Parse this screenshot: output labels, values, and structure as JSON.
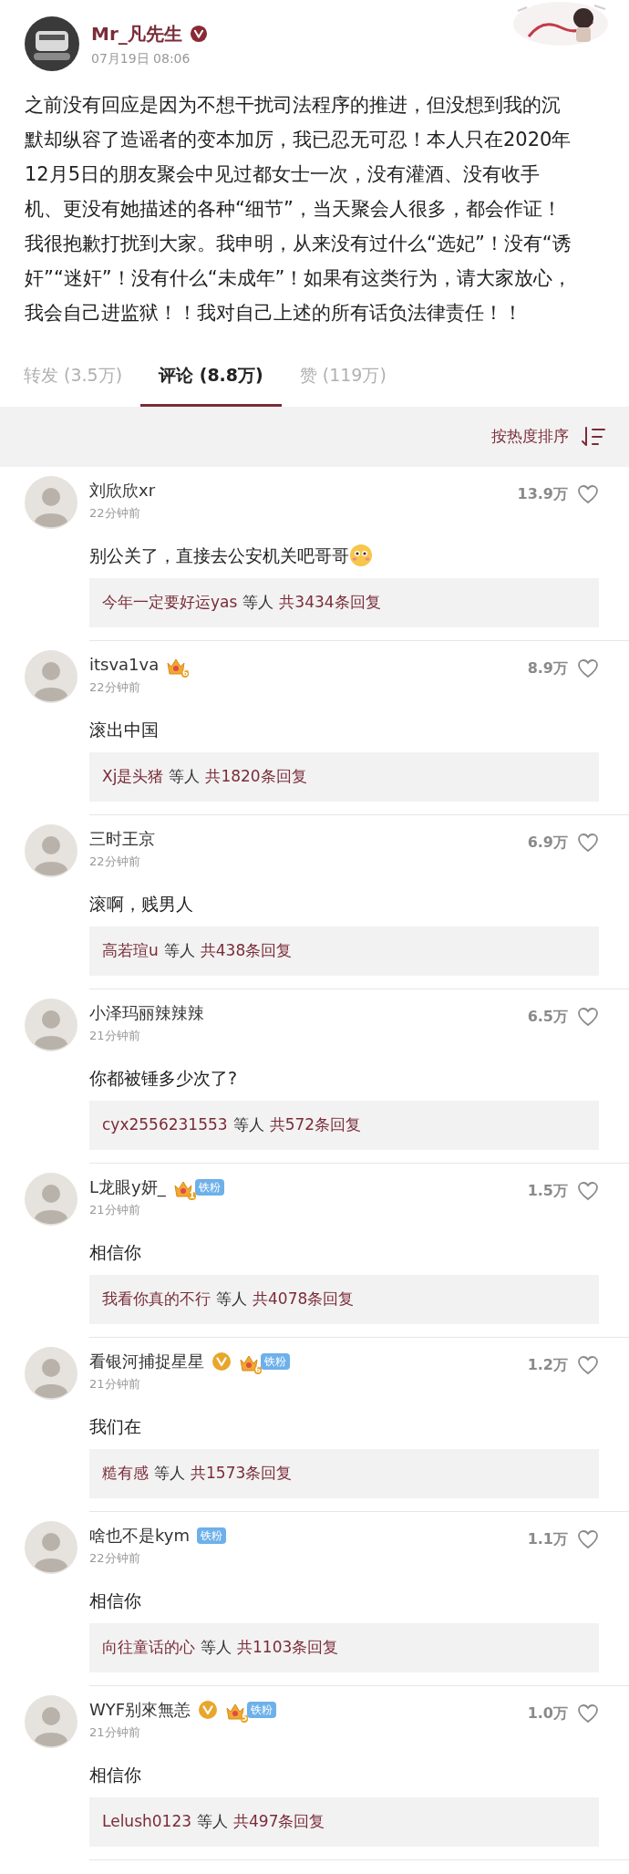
{
  "post": {
    "author": "Mr_凡先生",
    "verified": true,
    "time": "07月19日 08:06",
    "text": "之前没有回应是因为不想干扰司法程序的推进，但没想到我的沉默却纵容了造谣者的变本加厉，我已忍无可忍！本人只在2020年12月5日的朋友聚会中见过都女士一次，没有灌酒、没有收手机、更没有她描述的各种“细节”，当天聚会人很多，都会作证！我很抱歉打扰到大家。我申明，从来没有过什么“选妃”！没有“诱奸”“迷奸”！没有什么“未成年”！如果有这类行为，请大家放心，我会自己进监狱！！我对自己上述的所有话负法律责任！！"
  },
  "tabs": [
    {
      "label": "转发 (3.5万)",
      "selected": false
    },
    {
      "label": "评论 (8.8万)",
      "selected": true
    },
    {
      "label": "赞 (119万)",
      "selected": false
    }
  ],
  "sort": {
    "label": "按热度排序"
  },
  "comments": [
    {
      "name": "刘欣欣xr",
      "verified": false,
      "time": "22分钟前",
      "likes": "13.9万",
      "text": "别公关了，直接去公安机关吧哥哥",
      "emoji": true,
      "reply": {
        "user": "今年一定要好运yas",
        "middle": "等人",
        "total": "共3434条回复"
      }
    },
    {
      "name": "itsva1va",
      "verified": false,
      "crown_level": "6",
      "time": "22分钟前",
      "likes": "8.9万",
      "text": "滚出中国",
      "emoji": false,
      "reply": {
        "user": "Xj是头猪",
        "middle": "等人",
        "total": "共1820条回复"
      }
    },
    {
      "name": "三时王京",
      "verified": false,
      "time": "22分钟前",
      "likes": "6.9万",
      "text": "滚啊，贱男人",
      "emoji": false,
      "reply": {
        "user": "高若瑄u",
        "middle": "等人",
        "total": "共438条回复"
      }
    },
    {
      "name": "小泽玛丽辣辣辣",
      "verified": false,
      "time": "21分钟前",
      "likes": "6.5万",
      "text": "你都被锤多少次了?",
      "emoji": false,
      "reply": {
        "user": "cyx2556231553",
        "middle": "等人",
        "total": "共572条回复"
      }
    },
    {
      "name": "L龙眼y妍_",
      "verified": false,
      "crown_level": "1",
      "fan_badge": "铁粉",
      "time": "21分钟前",
      "likes": "1.5万",
      "text": "相信你",
      "emoji": false,
      "reply": {
        "user": "我看你真的不行",
        "middle": "等人",
        "total": "共4078条回复"
      }
    },
    {
      "name": "看银河捕捉星星",
      "verified": true,
      "crown_level": "6",
      "fan_badge": "铁粉",
      "time": "21分钟前",
      "likes": "1.2万",
      "text": "我们在",
      "emoji": false,
      "reply": {
        "user": "糙有感",
        "middle": "等人",
        "total": "共1573条回复"
      }
    },
    {
      "name": "啥也不是kym",
      "verified": false,
      "fan_badge": "铁粉",
      "time": "22分钟前",
      "likes": "1.1万",
      "text": "相信你",
      "emoji": false,
      "reply": {
        "user": "向往童话的心",
        "middle": "等人",
        "total": "共1103条回复"
      }
    },
    {
      "name": "WYF别來無恙",
      "verified": true,
      "crown_level": "5",
      "fan_badge": "铁粉",
      "time": "21分钟前",
      "likes": "1.0万",
      "text": "相信你",
      "emoji": false,
      "reply": {
        "user": "Lelush0123",
        "middle": "等人",
        "total": "共497条回复"
      }
    }
  ]
}
